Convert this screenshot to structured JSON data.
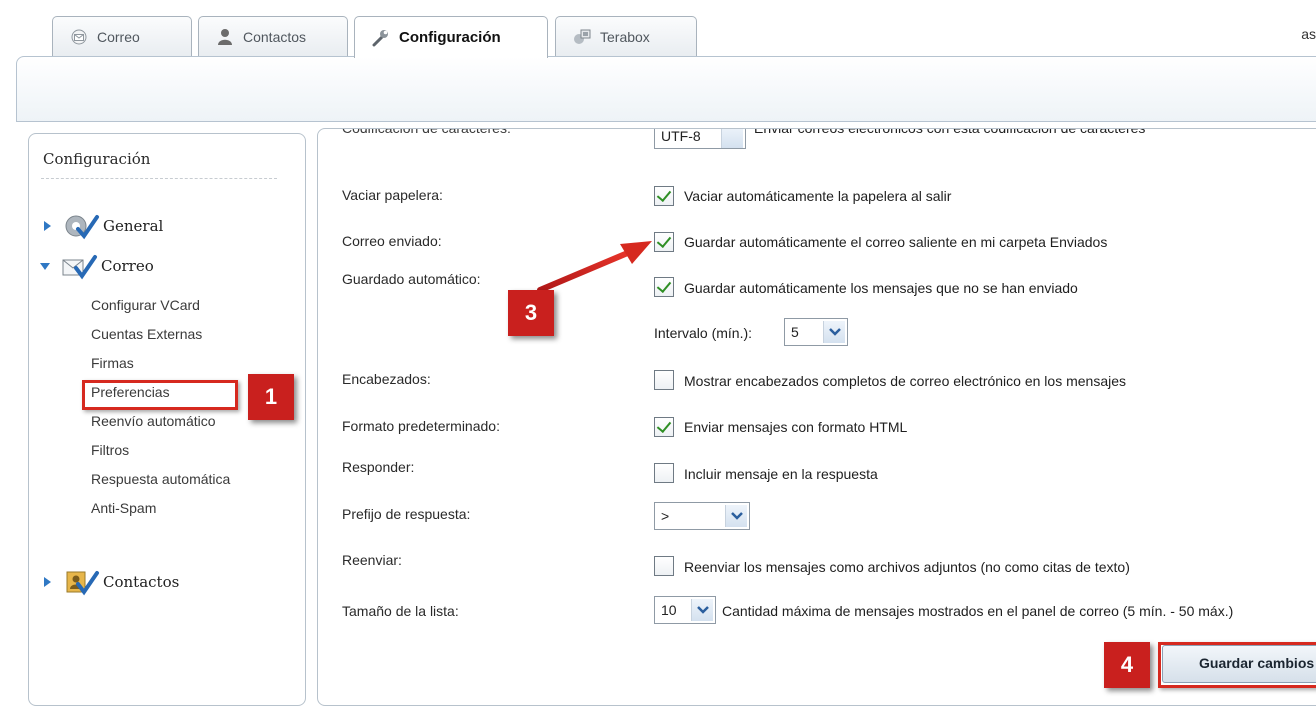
{
  "tabs": [
    {
      "label": "Correo",
      "icon": "mail-icon"
    },
    {
      "label": "Contactos",
      "icon": "contacts-icon"
    },
    {
      "label": "Configuración",
      "icon": "wrench-icon"
    },
    {
      "label": "Terabox",
      "icon": "terabox-icon"
    }
  ],
  "account_label": "as",
  "sidebar": {
    "title": "Configuración",
    "nodes": [
      {
        "label": "General",
        "icon": "general-settings-icon",
        "expanded": false
      },
      {
        "label": "Correo",
        "icon": "mail-settings-icon",
        "expanded": true
      },
      {
        "label": "Contactos",
        "icon": "contacts-settings-icon",
        "expanded": false
      }
    ],
    "correo_items": [
      "Configurar VCard",
      "Cuentas Externas",
      "Firmas",
      "Preferencias",
      "Reenvío automático",
      "Filtros",
      "Respuesta automática",
      "Anti-Spam"
    ]
  },
  "settings": {
    "encoding_cut": {
      "label": "Codificación de caracteres:",
      "value": "UTF-8",
      "text": "Enviar correos electrónicos con esta codificación de caracteres"
    },
    "vaciar": {
      "label": "Vaciar papelera:",
      "text": "Vaciar automáticamente la papelera al salir",
      "checked": true
    },
    "enviado": {
      "label": "Correo enviado:",
      "text": "Guardar automáticamente el correo saliente en mi carpeta Enviados",
      "checked": true
    },
    "guardado": {
      "label": "Guardado automático:",
      "text": "Guardar automáticamente los mensajes que no se han enviado",
      "checked": true
    },
    "intervalo": {
      "label": "Intervalo (mín.):",
      "value": "5"
    },
    "encabezados": {
      "label": "Encabezados:",
      "text": "Mostrar encabezados completos de correo electrónico en los mensajes",
      "checked": false
    },
    "formato": {
      "label": "Formato predeterminado:",
      "text": "Enviar mensajes con formato HTML",
      "checked": true
    },
    "responder": {
      "label": "Responder:",
      "text": "Incluir mensaje en la respuesta",
      "checked": false
    },
    "prefijo": {
      "label": "Prefijo de respuesta:",
      "value": ">"
    },
    "reenviar": {
      "label": "Reenviar:",
      "text": "Reenviar los mensajes como archivos adjuntos (no como citas de texto)",
      "checked": false
    },
    "lista": {
      "label": "Tamaño de la lista:",
      "value": "10",
      "text": "Cantidad máxima de mensajes mostrados en el panel de correo (5 mín. - 50 máx.)"
    }
  },
  "save_button": "Guardar cambios",
  "annotations": [
    "1",
    "3",
    "4"
  ],
  "colors": {
    "annotation_red": "#c9201e",
    "check_green": "#2f8f25",
    "border": "#b7c2cc"
  }
}
